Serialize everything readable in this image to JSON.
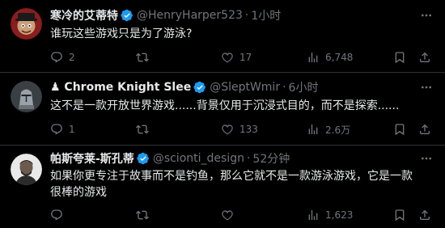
{
  "tweets": [
    {
      "name": "寒冷的艾蒂特",
      "handle": "@HenryHarper523",
      "time": "1小时",
      "text": "谁玩这些游戏只是为了游泳?",
      "replies": "2",
      "retweets": "",
      "likes": "17",
      "views": "6,748"
    },
    {
      "name": "♟ Chrome Knight Slee",
      "handle": "@SleptWmir",
      "time": "6小时",
      "text": "这不是一款开放世界游戏......背景仅用于沉浸式目的，而不是探索......",
      "replies": "1",
      "retweets": "",
      "likes": "133",
      "views": "2.6万"
    },
    {
      "name": "帕斯夸莱-斯孔蒂",
      "handle": "@scionti_design",
      "time": "52分钟",
      "text": "如果你更专注于故事而不是钓鱼，那么它就不是一款游泳游戏，它是一款很棒的游戏",
      "replies": "",
      "retweets": "",
      "likes": "",
      "views": "1,623"
    }
  ],
  "colors": {
    "background": "#000000",
    "text": "#e7e9ea",
    "muted": "#71767b",
    "verified": "#1d9bf0",
    "divider": "#2f3336"
  },
  "icons": [
    "verified-badge-icon",
    "more-icon",
    "reply-icon",
    "retweet-icon",
    "like-icon",
    "views-icon",
    "bookmark-icon",
    "share-icon"
  ]
}
